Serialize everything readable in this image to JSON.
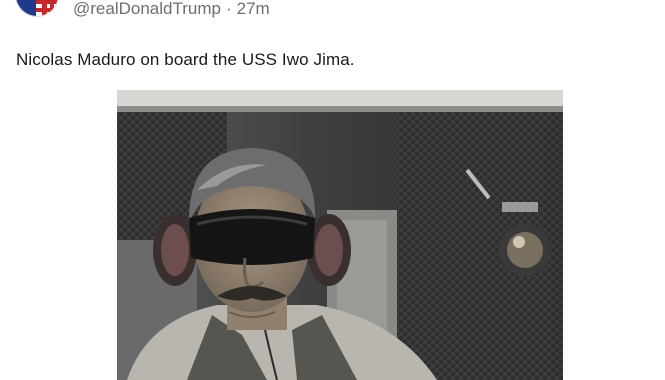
{
  "post": {
    "handle": "@realDonaldTrump",
    "separator": "·",
    "time_ago": "27m",
    "text": "Nicolas Maduro on board the USS Iwo Jima.",
    "avatar_icon": "flag-avatar-icon",
    "media_icon": "photo-image"
  },
  "colors": {
    "meta_text": "#6f6f6f",
    "body_text": "#1a1a1a",
    "background": "#ffffff"
  }
}
